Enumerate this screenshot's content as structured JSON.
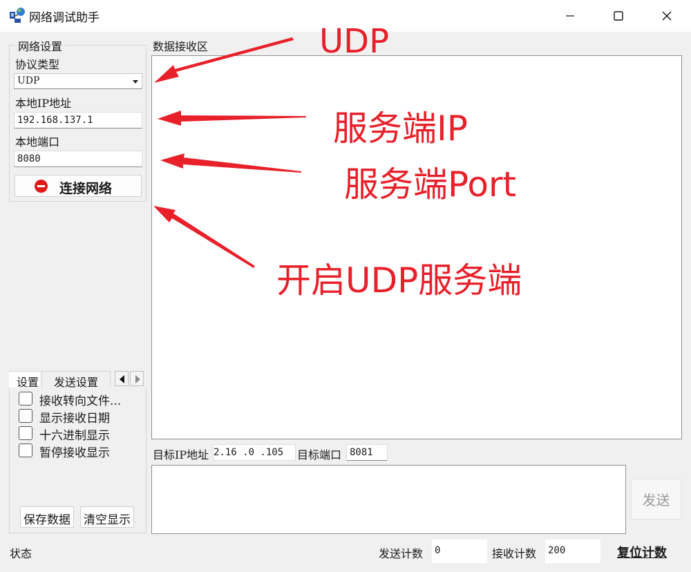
{
  "window": {
    "title": "网络调试助手",
    "minimize_icon": "minimize-icon",
    "maximize_icon": "maximize-icon",
    "close_icon": "close-icon"
  },
  "network_settings": {
    "group_title": "网络设置",
    "protocol_label": "协议类型",
    "protocol_value": "UDP",
    "local_ip_label": "本地IP地址",
    "local_ip_value": "192.168.137.1",
    "local_port_label": "本地端口",
    "local_port_value": "8080",
    "connect_label": "连接网络",
    "connect_icon": "stop-icon"
  },
  "receive": {
    "title": "数据接收区",
    "content": ""
  },
  "settings_tabs": {
    "active_tab_label": "设置",
    "inactive_tab_label": "发送设置",
    "options": [
      {
        "label": "接收转向文件...",
        "checked": false
      },
      {
        "label": "显示接收日期",
        "checked": false
      },
      {
        "label": "十六进制显示",
        "checked": false
      },
      {
        "label": "暂停接收显示",
        "checked": false
      }
    ],
    "save_label": "保存数据",
    "clear_label": "清空显示"
  },
  "send": {
    "target_ip_label": "目标IP地址",
    "target_ip_value": "2.16 .0  .105",
    "target_port_label": "目标端口",
    "target_port_value": "8081",
    "send_label": "发送",
    "content": ""
  },
  "status_bar": {
    "status_label": "状态",
    "sent_count_label": "发送计数",
    "sent_count_value": "0",
    "recv_count_label": "接收计数",
    "recv_count_value": "200",
    "reset_label": "复位计数"
  },
  "annotations": {
    "color": "#e8202a",
    "udp": "UDP",
    "server_ip": "服务端IP",
    "server_port": "服务端Port",
    "start_server": "开启UDP服务端"
  }
}
